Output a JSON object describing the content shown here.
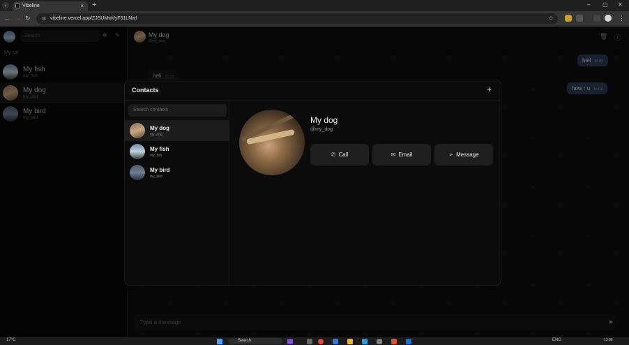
{
  "browser": {
    "tab_title": "Vibeline",
    "url": "vibeline.vercel.app/ZJSUMwVyF51LNwI",
    "add_tab": "+",
    "tab_close": "×",
    "win_minimize": "–",
    "win_maximize": "▢",
    "win_close": "✕"
  },
  "sidebar": {
    "search_placeholder": "Search",
    "section_label": "My cat",
    "chats": [
      {
        "name": "My fish",
        "handle": "my_fish"
      },
      {
        "name": "My dog",
        "handle": "my_dog"
      },
      {
        "name": "My bird",
        "handle": "my_bird"
      }
    ]
  },
  "chat": {
    "name": "My dog",
    "handle": "@my_dog",
    "messages": [
      {
        "text": "hell",
        "time": "15:03",
        "direction": "out"
      },
      {
        "text": "heli",
        "time": "15:03",
        "direction": "in"
      },
      {
        "text": "how r u",
        "time": "15:03",
        "direction": "out"
      }
    ],
    "input_placeholder": "Type a message"
  },
  "contacts_dialog": {
    "title": "Contacts",
    "add_button": "+",
    "search_placeholder": "Search contacts",
    "contacts": [
      {
        "name": "My dog",
        "handle": "my_dog"
      },
      {
        "name": "My fish",
        "handle": "my_fish"
      },
      {
        "name": "My bird",
        "handle": "my_bird"
      }
    ],
    "selected": {
      "name": "My dog",
      "handle": "@my_dog",
      "actions": {
        "call": "Call",
        "email": "Email",
        "message": "Message"
      }
    }
  },
  "taskbar": {
    "weather": "17°C",
    "search_label": "Search",
    "language": "ENG",
    "clock": "13:08"
  },
  "colors": {
    "accent_bubble": "#2f3d5a",
    "background": "#0b0b0b"
  }
}
